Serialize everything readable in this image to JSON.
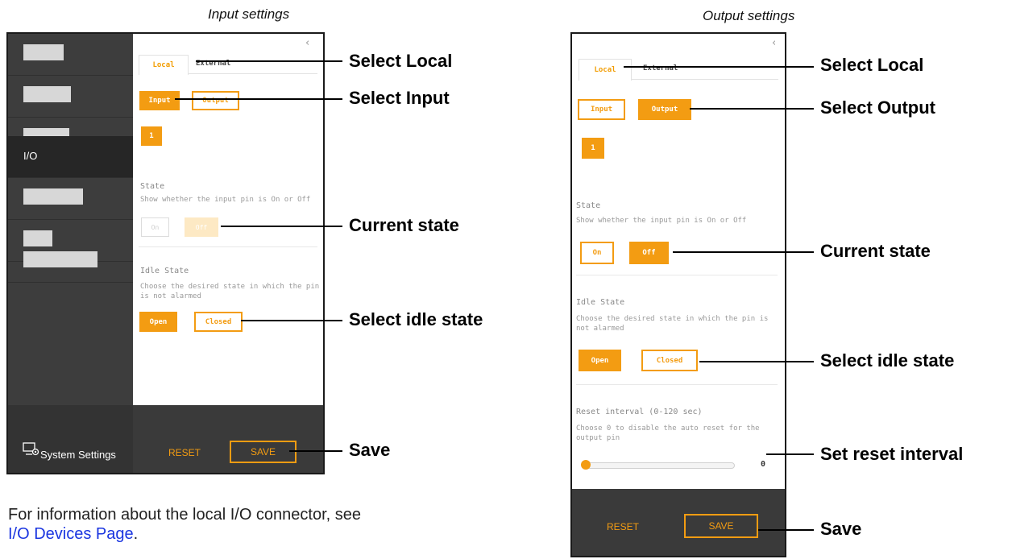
{
  "captions": {
    "input": "Input settings",
    "output": "Output settings"
  },
  "sidebar": {
    "active_item": "I/O",
    "system_settings": "System Settings"
  },
  "tabs": {
    "local": "Local",
    "external": "External"
  },
  "input_panel": {
    "direction": {
      "input": "Input",
      "output": "Output",
      "selected": "Input"
    },
    "pin": "1",
    "state": {
      "title": "State",
      "desc": "Show whether the input pin is On or Off",
      "on": "On",
      "off": "Off"
    },
    "idle": {
      "title": "Idle State",
      "desc": "Choose the desired state in which the pin is not alarmed",
      "open": "Open",
      "closed": "Closed"
    },
    "footer": {
      "reset": "RESET",
      "save": "SAVE"
    }
  },
  "output_panel": {
    "direction": {
      "input": "Input",
      "output": "Output",
      "selected": "Output"
    },
    "pin": "1",
    "state": {
      "title": "State",
      "desc": "Show whether the input pin is On or Off",
      "on": "On",
      "off": "Off"
    },
    "idle": {
      "title": "Idle State",
      "desc": "Choose the desired state in which the pin is not alarmed",
      "open": "Open",
      "closed": "Closed"
    },
    "reset_interval": {
      "title": "Reset interval (0-120 sec)",
      "desc": "Choose 0 to disable the auto reset for the output pin",
      "value": "0"
    },
    "footer": {
      "reset": "RESET",
      "save": "SAVE"
    }
  },
  "callouts": {
    "input": {
      "select_local": "Select Local",
      "select_input": "Select Input",
      "current_state": "Current state",
      "select_idle": "Select idle state",
      "save": "Save"
    },
    "output": {
      "select_local": "Select Local",
      "select_output": "Select Output",
      "current_state": "Current state",
      "select_idle": "Select idle state",
      "set_reset": "Set reset interval",
      "save": "Save"
    }
  },
  "info": {
    "text": "For information about the local I/O connector, see",
    "link": "I/O Devices Page",
    "suffix": "."
  },
  "colors": {
    "accent": "#f39c12",
    "sidebar": "#3d3d3d",
    "footer": "#3a3a3a",
    "link": "#1a35e0"
  }
}
